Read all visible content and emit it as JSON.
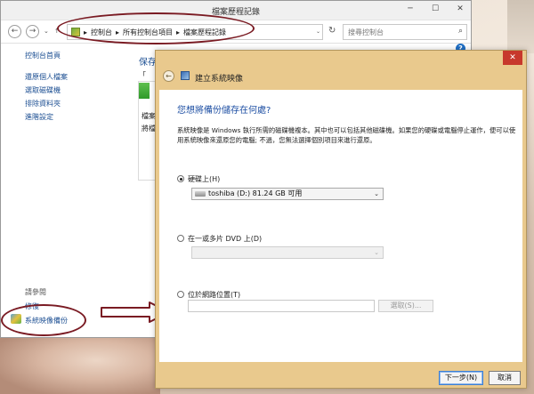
{
  "back_window": {
    "title": "檔案歷程記錄",
    "controls": {
      "minimize": "─",
      "maximize": "☐",
      "close": "✕"
    },
    "nav": {
      "back": "←",
      "forward": "→",
      "dropdown": "⌄",
      "up": "↑"
    },
    "breadcrumb": [
      "控制台",
      "所有控制台項目",
      "檔案歷程記錄"
    ],
    "breadcrumb_sep": "▸",
    "refresh": "↻",
    "search_placeholder": "搜尋控制台",
    "search_icon": "⌕",
    "help": "?",
    "left_pane": {
      "home": "控制台首頁",
      "items": [
        "還原個人檔案",
        "選取磁碟機",
        "排除資料夾",
        "進階設定"
      ],
      "see_also": "請參閱",
      "see_also_items": [
        "修復",
        "系統映像備份"
      ]
    },
    "content": {
      "heading": "保存",
      "quote": "「",
      "text1": "檔案",
      "text2": "將檔"
    }
  },
  "dialog": {
    "title": "建立系統映像",
    "close": "✕",
    "back": "←",
    "question": "您想將備份儲存在何處?",
    "description": "系統映像是 Windows 執行所需的磁碟機複本。其中也可以包括其他磁碟機。如果您的硬碟或電腦停止運作，便可以使用系統映像來還原您的電腦; 不過，您無法選擇個別項目來進行還原。",
    "options": {
      "hard_disk": {
        "label": "硬碟上(H)",
        "selected": true,
        "value": "toshiba (D:)  81.24 GB 可用"
      },
      "dvd": {
        "label": "在一或多片 DVD 上(D)",
        "selected": false,
        "value": ""
      },
      "network": {
        "label": "位於網路位置(T)",
        "selected": false,
        "value": "",
        "browse": "選取(S)..."
      }
    },
    "dropdown_arrow": "⌄",
    "buttons": {
      "next": "下一步(N)",
      "cancel": "取消"
    }
  },
  "colors": {
    "annotation": "#7a1b23",
    "dialog_frame": "#e9c98d",
    "link": "#1b4e92",
    "heading": "#1e4fa3"
  }
}
